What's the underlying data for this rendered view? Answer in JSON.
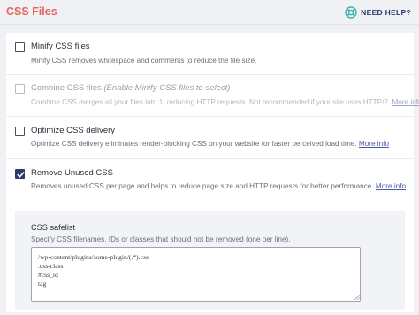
{
  "header": {
    "title": "CSS Files",
    "help_label": "NEED HELP?",
    "accent_color": "#e2665f",
    "help_icon": "lifebuoy-icon"
  },
  "options": [
    {
      "title": "Minify CSS files",
      "title_em": "",
      "description": "Minify CSS removes whitespace and comments to reduce the file size.",
      "link": "",
      "checked": false,
      "disabled": false
    },
    {
      "title": "Combine CSS files ",
      "title_em": "(Enable Minify CSS files to select)",
      "description": "Combine CSS merges all your files into 1, reducing HTTP requests. Not recommended if your site uses HTTP/2. ",
      "link": "More info",
      "checked": false,
      "disabled": true
    },
    {
      "title": "Optimize CSS delivery",
      "title_em": "",
      "description": "Optimize CSS delivery eliminates render-blocking CSS on your website for faster perceived load time. ",
      "link": "More info",
      "checked": false,
      "disabled": false
    },
    {
      "title": "Remove Unused CSS",
      "title_em": "",
      "description": "Removes unused CSS per page and helps to reduce page size and HTTP requests for better performance. ",
      "link": "More info",
      "checked": true,
      "disabled": false
    }
  ],
  "safelist": {
    "title": "CSS safelist",
    "description": "Specify CSS filenames, IDs or classes that should not be removed (one per line).",
    "value": "/wp-content/plugins/some-plugin/(.*).css\n.css-class\n#css_id\ntag"
  }
}
